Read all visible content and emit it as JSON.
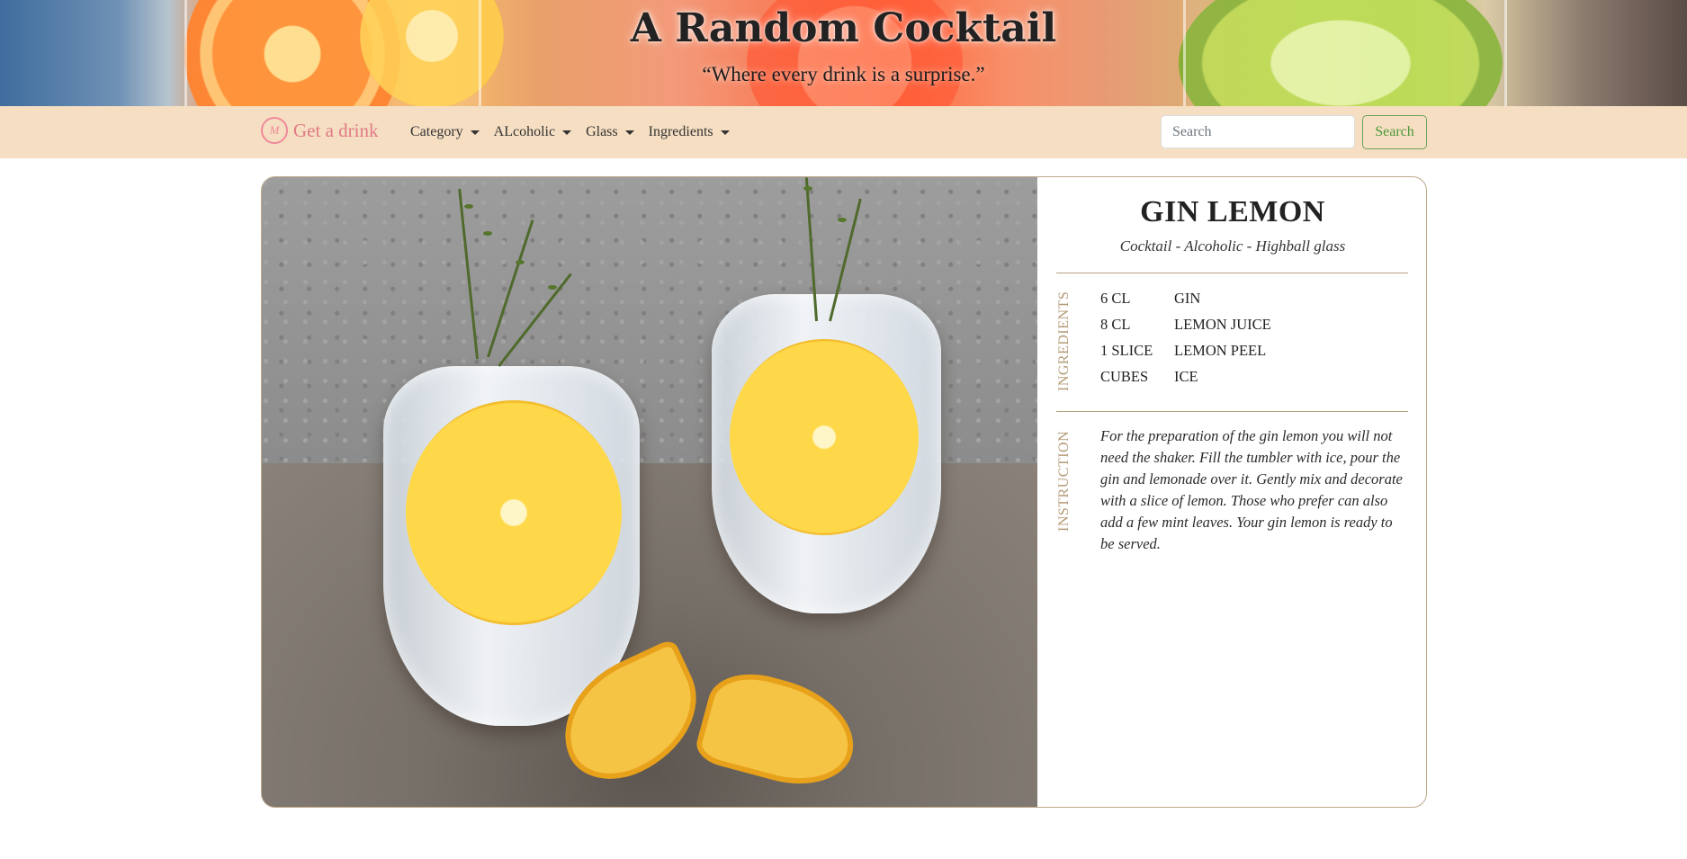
{
  "hero": {
    "title": "A Random Cocktail",
    "subtitle": "“Where every drink is a surprise.”"
  },
  "navbar": {
    "brand_logo_text": "M",
    "brand_label": "Get a drink",
    "menu": [
      {
        "label": "Category"
      },
      {
        "label": "ALcoholic"
      },
      {
        "label": "Glass"
      },
      {
        "label": "Ingredients"
      }
    ],
    "search": {
      "placeholder": "Search",
      "button_label": "Search"
    }
  },
  "drink": {
    "name": "GIN LEMON",
    "meta": "Cocktail - Alcoholic - Highball glass",
    "ingredients_label": "INGREDIENTS",
    "ingredients": [
      {
        "qty": "6 CL",
        "name": "GIN"
      },
      {
        "qty": "8 CL",
        "name": "LEMON JUICE"
      },
      {
        "qty": "1 SLICE",
        "name": "LEMON PEEL"
      },
      {
        "qty": "CUBES",
        "name": "ICE"
      }
    ],
    "instruction_label": "INSTRUCTION",
    "instructions": "For the preparation of the gin lemon you will not need the shaker. Fill the tumbler with ice, pour the gin and lemonade over it. Gently mix and decorate with a slice of lemon. Those who prefer can also add a few mint leaves. Your gin lemon is ready to be served."
  },
  "colors": {
    "navbar_bg": "#f5dec2",
    "brand": "#e07a86",
    "search_button": "#4e9a3c",
    "card_border": "#bfa889",
    "side_label": "#b49a76"
  }
}
